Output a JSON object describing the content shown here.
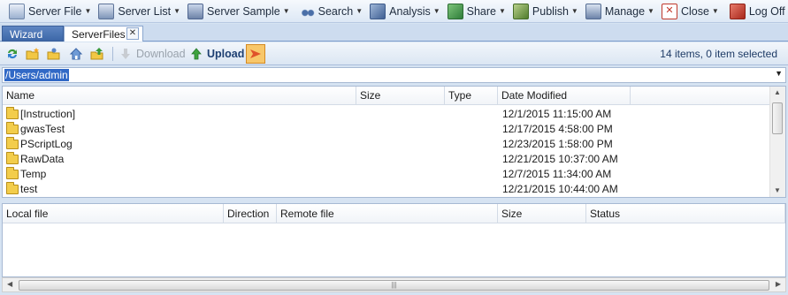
{
  "menu": {
    "items": [
      {
        "label": "Server File",
        "icon": "server-file-icon",
        "dropdown": true
      },
      {
        "label": "Server List",
        "icon": "server-list-icon",
        "dropdown": true
      },
      {
        "label": "Server Sample",
        "icon": "server-sample-icon",
        "dropdown": true
      },
      {
        "label": "Search",
        "icon": "binoculars-icon",
        "dropdown": true
      },
      {
        "label": "Analysis",
        "icon": "analysis-icon",
        "dropdown": true
      },
      {
        "label": "Share",
        "icon": "share-icon",
        "dropdown": true
      },
      {
        "label": "Publish",
        "icon": "publish-icon",
        "dropdown": true
      },
      {
        "label": "Manage",
        "icon": "manage-icon",
        "dropdown": true
      },
      {
        "label": "Close",
        "icon": "close-window-icon",
        "dropdown": true
      },
      {
        "label": "Log Off",
        "icon": "log-off-icon",
        "dropdown": false
      }
    ]
  },
  "tabs": {
    "wizard": "Wizard",
    "serverfiles": "ServerFiles",
    "close_glyph": "✕"
  },
  "toolbar": {
    "download_label": "Download",
    "upload_label": "Upload",
    "status": "14 items, 0 item selected"
  },
  "path": {
    "value": "/Users/admin"
  },
  "filelist": {
    "columns": [
      "Name",
      "Size",
      "Type",
      "Date Modified"
    ],
    "rows": [
      {
        "name": "[Instruction]",
        "date": "12/1/2015 11:15:00 AM"
      },
      {
        "name": "gwasTest",
        "date": "12/17/2015 4:58:00 PM"
      },
      {
        "name": "PScriptLog",
        "date": "12/23/2015 1:58:00 PM"
      },
      {
        "name": "RawData",
        "date": "12/21/2015 10:37:00 AM"
      },
      {
        "name": "Temp",
        "date": "12/7/2015 11:34:00 AM"
      },
      {
        "name": "test",
        "date": "12/21/2015 10:44:00 AM"
      }
    ]
  },
  "transfer": {
    "columns": [
      "Local file",
      "Direction",
      "Remote file",
      "Size",
      "Status"
    ]
  },
  "colors": {
    "accent": "#3169c6",
    "tab_active": "#3d67a8"
  }
}
